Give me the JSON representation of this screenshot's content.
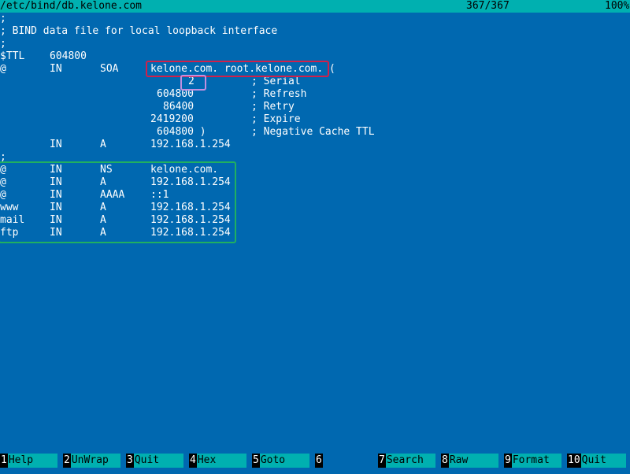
{
  "titlebar": {
    "path": "/etc/bind/db.kelone.com",
    "position": "367/367",
    "percent": "100%"
  },
  "lines": [
    {
      "cols": [
        ";"
      ]
    },
    {
      "cols": [
        "; BIND data file for local loopback interface"
      ]
    },
    {
      "cols": [
        ";"
      ]
    },
    {
      "cols": [
        "$TTL",
        "604800"
      ]
    },
    {
      "cols": [
        "@",
        "IN",
        "SOA",
        "kelone.com. root.kelone.com. ("
      ]
    },
    {
      "cols": [
        "2",
        "; Serial"
      ]
    },
    {
      "cols": [
        "604800",
        "; Refresh"
      ]
    },
    {
      "cols": [
        "86400",
        "; Retry"
      ]
    },
    {
      "cols": [
        "2419200",
        "; Expire"
      ]
    },
    {
      "cols": [
        "604800 )",
        "; Negative Cache TTL"
      ]
    },
    {
      "cols": [
        "IN",
        "A",
        "192.168.1.254"
      ]
    },
    {
      "cols": [
        ";"
      ]
    },
    {
      "cols": [
        "@",
        "IN",
        "NS",
        "kelone.com."
      ]
    },
    {
      "cols": [
        "@",
        "IN",
        "A",
        "192.168.1.254"
      ]
    },
    {
      "cols": [
        "@",
        "IN",
        "AAAA",
        "::1"
      ]
    },
    {
      "cols": [
        "www",
        "IN",
        "A",
        "192.168.1.254"
      ]
    },
    {
      "cols": [
        "mail",
        "IN",
        "A",
        "192.168.1.254"
      ]
    },
    {
      "cols": [
        "ftp",
        "IN",
        "A",
        "192.168.1.254"
      ]
    }
  ],
  "highlight_colors": {
    "soa_box": "#d0204a",
    "serial_box": "#c090e0",
    "records_box": "#20b060"
  },
  "fkeys": [
    {
      "num": "1",
      "label": "Help"
    },
    {
      "num": "2",
      "label": "UnWrap"
    },
    {
      "num": "3",
      "label": "Quit"
    },
    {
      "num": "4",
      "label": "Hex"
    },
    {
      "num": "5",
      "label": "Goto"
    },
    {
      "num": "6",
      "label": ""
    },
    {
      "num": "7",
      "label": "Search"
    },
    {
      "num": "8",
      "label": "Raw"
    },
    {
      "num": "9",
      "label": "Format"
    },
    {
      "num": "10",
      "label": "Quit"
    }
  ]
}
